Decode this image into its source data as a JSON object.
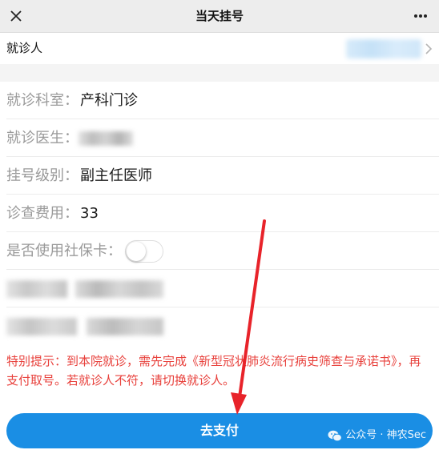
{
  "header": {
    "title": "当天挂号"
  },
  "patient": {
    "label": "就诊人"
  },
  "details": {
    "department": {
      "label": "就诊科室：",
      "value": "产科门诊"
    },
    "doctor": {
      "label": "就诊医生："
    },
    "level": {
      "label": "挂号级别：",
      "value": "副主任医师"
    },
    "fee": {
      "label": "诊查费用：",
      "value": "33"
    },
    "insurance": {
      "label": "是否使用社保卡：",
      "enabled": false
    }
  },
  "notice": "特别提示：到本院就诊，需先完成《新型冠状肺炎流行病史筛查与承诺书》，再支付取号。若就诊人不符，请切换就诊人。",
  "pay_button": {
    "label": "去支付"
  },
  "watermark": {
    "text": "公众号 · 神农Sec"
  },
  "colors": {
    "accent": "#1a8ee4",
    "notice": "#e8413c",
    "arrow": "#e8232a"
  }
}
